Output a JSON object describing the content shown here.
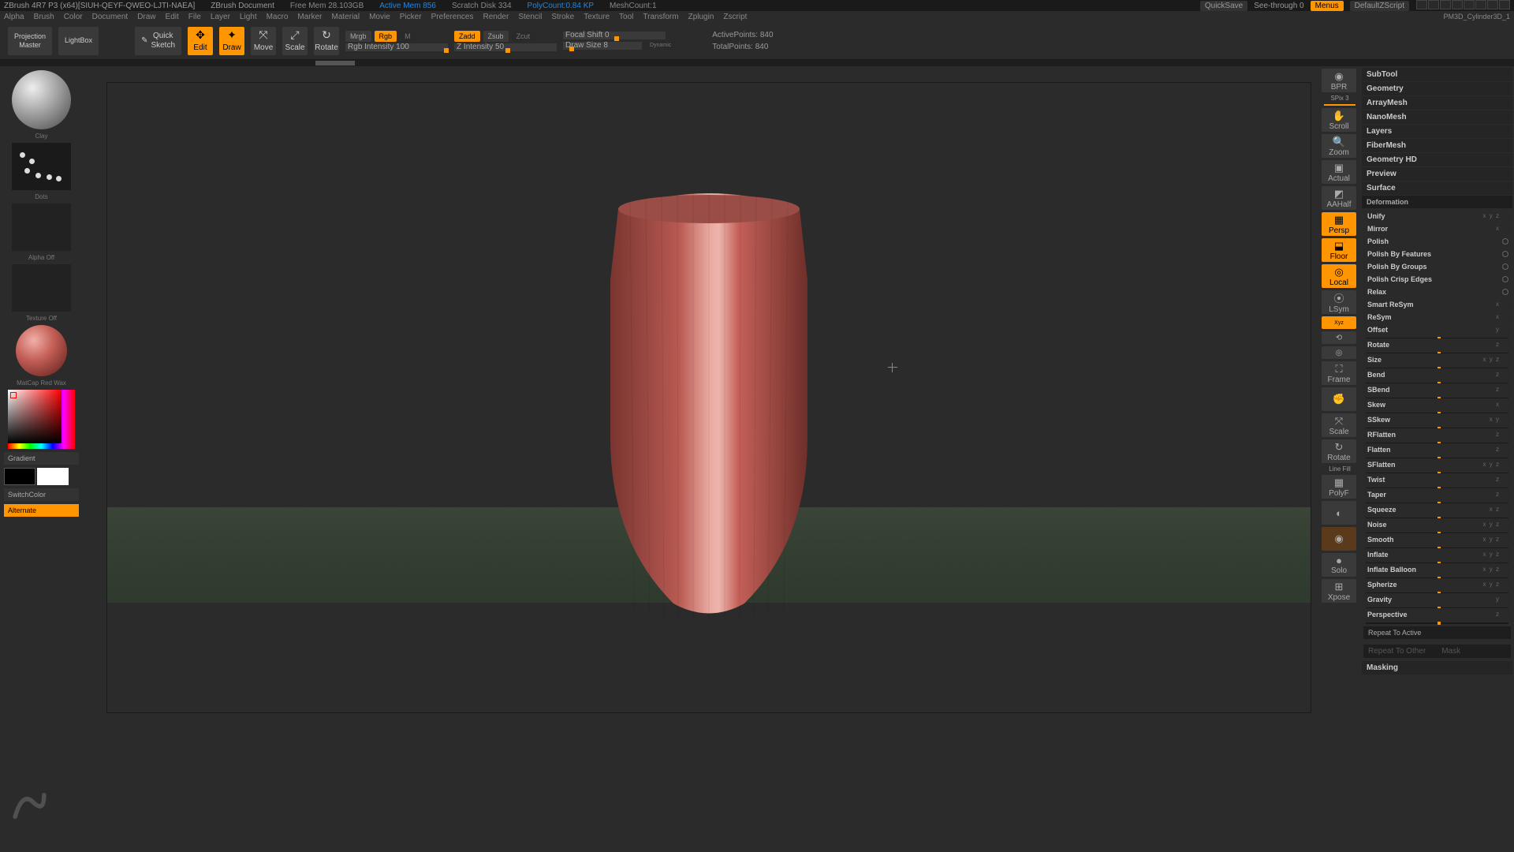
{
  "titlebar": {
    "app": "ZBrush 4R7 P3 (x64)[SIUH-QEYF-QWEO-LJTI-NAEA]",
    "doc": "ZBrush Document",
    "freemem": "Free Mem 28.103GB",
    "activemem": "Active Mem 856",
    "scratch": "Scratch Disk 334",
    "polycount": "PolyCount:0.84 KP",
    "meshcount": "MeshCount:1",
    "quicksave": "QuickSave",
    "seethrough": "See-through  0",
    "menus": "Menus",
    "defaultscript": "DefaultZScript",
    "toolname": "PM3D_Cylinder3D_1"
  },
  "menubar": {
    "items": [
      "Alpha",
      "Brush",
      "Color",
      "Document",
      "Draw",
      "Edit",
      "File",
      "Layer",
      "Light",
      "Macro",
      "Marker",
      "Material",
      "Movie",
      "Picker",
      "Preferences",
      "Render",
      "Stencil",
      "Stroke",
      "Texture",
      "Tool",
      "Transform",
      "Zplugin",
      "Zscript"
    ]
  },
  "toolbar": {
    "projection": "Projection\nMaster",
    "lightbox": "LightBox",
    "quicksketch": "Quick\nSketch",
    "edit": "Edit",
    "draw": "Draw",
    "move": "Move",
    "scale": "Scale",
    "rotate": "Rotate",
    "mrgb": "Mrgb",
    "rgb": "Rgb",
    "m": "M",
    "rgbintensity": "Rgb Intensity 100",
    "zadd": "Zadd",
    "zsub": "Zsub",
    "zcut": "Zcut",
    "zintensity": "Z Intensity 50",
    "focalshift": "Focal Shift 0",
    "drawsize": "Draw Size 8",
    "dynamic": "Dynamic",
    "activepoints": "ActivePoints: 840",
    "totalpoints": "TotalPoints: 840"
  },
  "leftpanel": {
    "brush": "Clay",
    "stroke": "Dots",
    "alpha": "Alpha Off",
    "texture": "Texture Off",
    "material": "MatCap Red Wax",
    "gradient": "Gradient",
    "switchcolor": "SwitchColor",
    "alternate": "Alternate"
  },
  "rightshelf": {
    "spix": "SPix 3",
    "items": [
      "BPR",
      "Scroll",
      "Zoom",
      "Actual",
      "AAHalf",
      "Persp",
      "Floor",
      "Local",
      "LSym",
      "Xyz",
      "",
      "",
      "Frame",
      "",
      "Scale",
      "Rotate",
      "PolyF",
      "",
      "Solo",
      "Xpose"
    ],
    "linefill": "Line Fill"
  },
  "rightpanel": {
    "sections": [
      "SubTool",
      "Geometry",
      "ArrayMesh",
      "NanoMesh",
      "Layers",
      "FiberMesh",
      "Geometry HD",
      "Preview",
      "Surface"
    ],
    "deformation_header": "Deformation",
    "deformations": [
      {
        "name": "Unify",
        "axis": "x y z"
      },
      {
        "name": "Mirror",
        "axis": "x"
      },
      {
        "name": "Polish",
        "circ": true
      },
      {
        "name": "Polish By Features",
        "circ": true
      },
      {
        "name": "Polish By Groups",
        "circ": true
      },
      {
        "name": "Polish Crisp Edges",
        "circ": true
      },
      {
        "name": "Relax",
        "circ": true
      },
      {
        "name": "Smart ReSym",
        "axis": "x"
      },
      {
        "name": "ReSym",
        "axis": "x"
      },
      {
        "name": "Offset",
        "axis": "y",
        "slider": true
      },
      {
        "name": "Rotate",
        "axis": "z",
        "slider": true
      },
      {
        "name": "Size",
        "axis": "x y z",
        "slider": true
      },
      {
        "name": "Bend",
        "axis": "z",
        "slider": true
      },
      {
        "name": "SBend",
        "axis": "z",
        "slider": true
      },
      {
        "name": "Skew",
        "axis": "x",
        "slider": true
      },
      {
        "name": "SSkew",
        "axis": "x y",
        "slider": true
      },
      {
        "name": "RFlatten",
        "axis": "z",
        "slider": true
      },
      {
        "name": "Flatten",
        "axis": "z",
        "slider": true
      },
      {
        "name": "SFlatten",
        "axis": "x y z",
        "slider": true
      },
      {
        "name": "Twist",
        "axis": "z",
        "slider": true
      },
      {
        "name": "Taper",
        "axis": "z",
        "slider": true
      },
      {
        "name": "Squeeze",
        "axis": "x   z",
        "slider": true
      },
      {
        "name": "Noise",
        "axis": "x y z",
        "slider": true
      },
      {
        "name": "Smooth",
        "axis": "x y z",
        "slider": true
      },
      {
        "name": "Inflate",
        "axis": "x y z",
        "slider": true
      },
      {
        "name": "Inflate Balloon",
        "axis": "x y z",
        "slider": true
      },
      {
        "name": "Spherize",
        "axis": "x y z",
        "slider": true
      },
      {
        "name": "Gravity",
        "axis": "y",
        "slider": true
      },
      {
        "name": "Perspective",
        "axis": "z",
        "slider": true
      }
    ],
    "repeat_active": "Repeat To Active",
    "repeat_other": "Repeat To Other",
    "mask": "Mask",
    "masking": "Masking"
  }
}
